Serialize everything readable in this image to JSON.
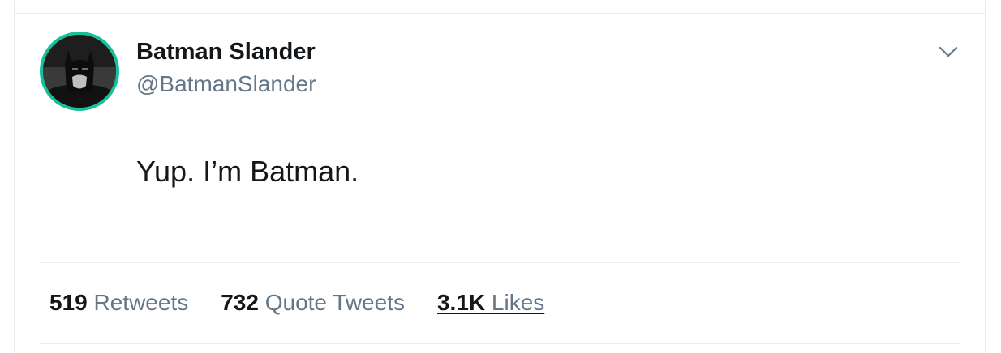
{
  "tweet": {
    "author": {
      "display_name": "Batman Slander",
      "handle": "@BatmanSlander"
    },
    "text": "Yup. I’m Batman.",
    "stats": {
      "retweets": {
        "count": "519",
        "label": "Retweets"
      },
      "quotes": {
        "count": "732",
        "label": "Quote Tweets"
      },
      "likes": {
        "count": "3.1K",
        "label": "Likes"
      }
    }
  },
  "colors": {
    "text_primary": "#14171a",
    "text_secondary": "#657786",
    "avatar_ring": "#17bf9b",
    "divider": "#e6ecf0"
  },
  "icons": {
    "menu_caret": "chevron-down-icon"
  }
}
